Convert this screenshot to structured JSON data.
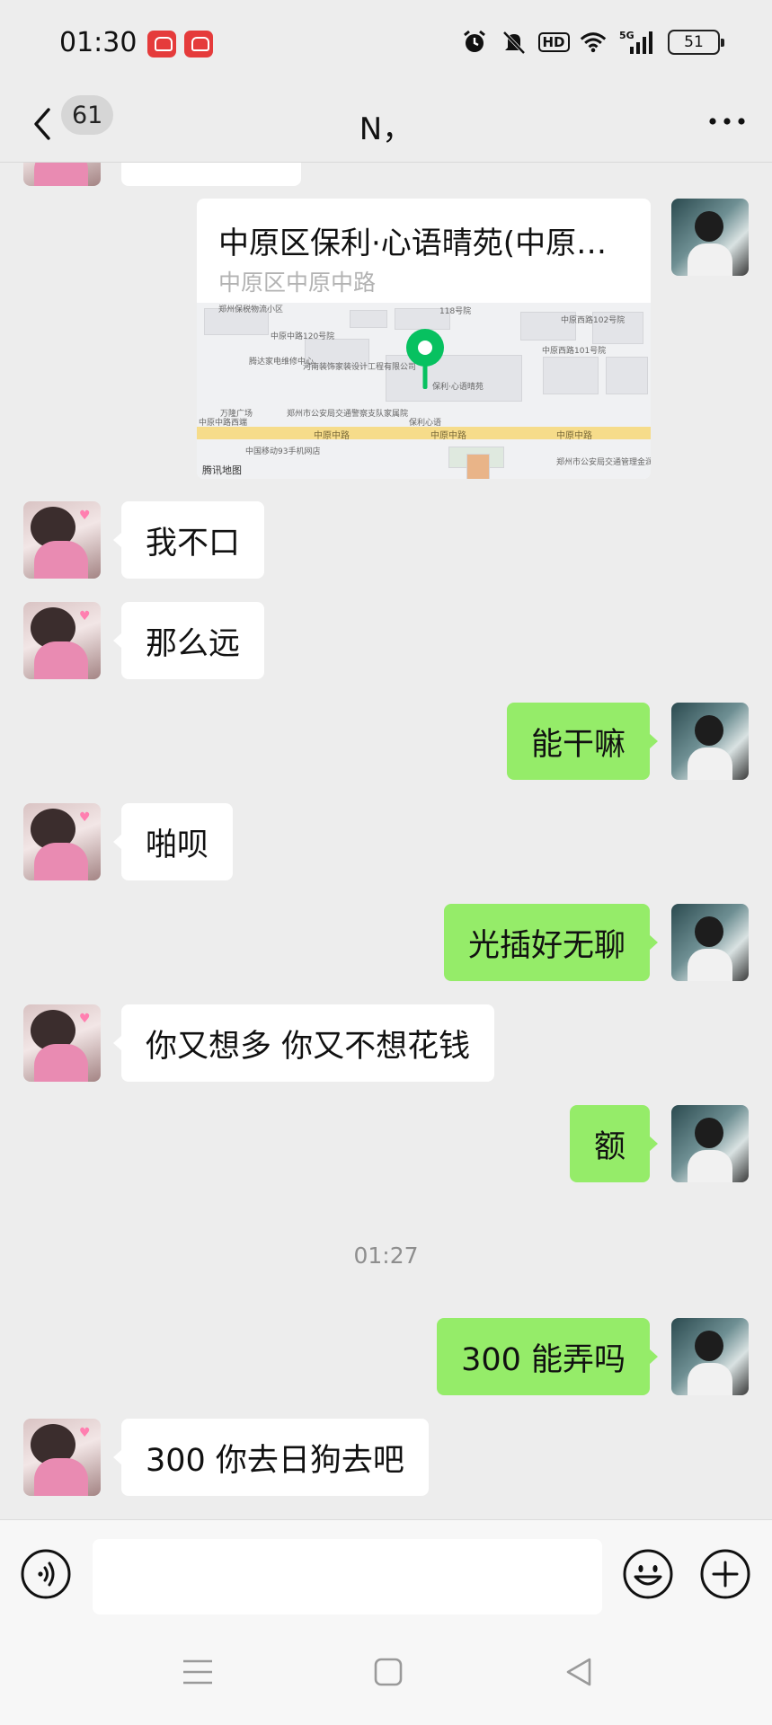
{
  "status_bar": {
    "time": "01:30",
    "battery": "51",
    "hd_label": "HD",
    "network_label": "5G",
    "icons": [
      "app-badge-icon",
      "app-badge-icon",
      "alarm-icon",
      "mute-icon",
      "hd-icon",
      "wifi-icon",
      "signal-5g-icon",
      "battery-icon"
    ]
  },
  "header": {
    "back_count": "61",
    "title": "N，",
    "icons": [
      "back-icon",
      "more-icon"
    ]
  },
  "location": {
    "title": "中原区保利·心语晴苑(中原中路...",
    "address": "中原区中原中路",
    "map_labels": [
      "郑州保税物流小区",
      "118号院",
      "中原西路102号院",
      "中原西路101号院",
      "中原中路120号院",
      "腾达家电维修中心",
      "河南装饰家装设计工程有限公司",
      "万隆广场",
      "中原中路西端",
      "郑州市公安局交通警察支队家属院",
      "保利·心语晴苑",
      "保利心语",
      "中原中路",
      "中国移动93手机网店",
      "郑州市公安局交通管理金润网新院",
      "腾讯地图"
    ],
    "map_logo": "腾讯地图"
  },
  "messages": [
    {
      "from": "other",
      "text": "我不口"
    },
    {
      "from": "other",
      "text": "那么远"
    },
    {
      "from": "self",
      "text": "能干嘛"
    },
    {
      "from": "other",
      "text": "啪呗"
    },
    {
      "from": "self",
      "text": "光插好无聊"
    },
    {
      "from": "other",
      "text": "你又想多  你又不想花钱"
    },
    {
      "from": "self",
      "text": "额"
    },
    {
      "from": "self",
      "text": "300 能弄吗"
    },
    {
      "from": "other",
      "text": "300 你去日狗去吧"
    }
  ],
  "time_divider": "01:27",
  "input": {
    "value": "",
    "placeholder": "",
    "icons": [
      "voice-icon",
      "emoji-icon",
      "plus-icon"
    ]
  },
  "nav_bar": {
    "icons": [
      "menu-icon",
      "home-icon",
      "back-triangle-icon"
    ]
  },
  "colors": {
    "background": "#ededed",
    "self_bubble": "#95ec69",
    "other_bubble": "#ffffff",
    "pin": "#07c160"
  }
}
